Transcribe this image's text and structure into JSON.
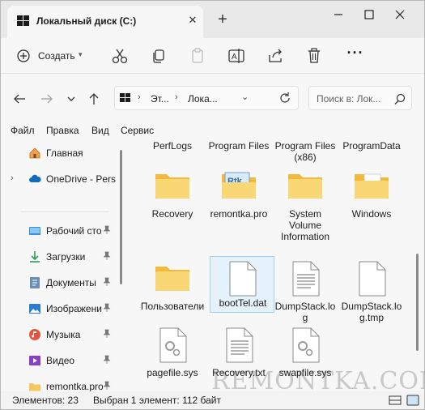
{
  "titlebar": {
    "tab_title": "Локальный диск (C:)",
    "close_glyph": "✕",
    "new_tab_glyph": "+"
  },
  "toolbar": {
    "create_label": "Создать",
    "buttons": [
      "cut-icon",
      "copy-icon",
      "paste-icon",
      "rename-icon",
      "share-icon",
      "delete-icon"
    ],
    "more_glyph": "···"
  },
  "address": {
    "segments": [
      "Эт...",
      "Лока..."
    ],
    "separator": "›",
    "search_placeholder": "Поиск в: Лок..."
  },
  "menu": [
    "Файл",
    "Правка",
    "Вид",
    "Сервис"
  ],
  "sidebar": {
    "items": [
      {
        "label": "Главная",
        "icon": "home-icon",
        "pinned": false,
        "chevron": false
      },
      {
        "label": "OneDrive - Perso",
        "icon": "cloud-icon",
        "pinned": false,
        "chevron": true
      },
      {
        "label": "Рабочий сто",
        "icon": "desktop-icon",
        "pinned": true,
        "chevron": false
      },
      {
        "label": "Загрузки",
        "icon": "download-icon",
        "pinned": true,
        "chevron": false
      },
      {
        "label": "Документы",
        "icon": "documents-icon",
        "pinned": true,
        "chevron": false
      },
      {
        "label": "Изображени",
        "icon": "pictures-icon",
        "pinned": true,
        "chevron": false
      },
      {
        "label": "Музыка",
        "icon": "music-icon",
        "pinned": true,
        "chevron": false
      },
      {
        "label": "Видео",
        "icon": "video-icon",
        "pinned": true,
        "chevron": false
      },
      {
        "label": "remontka.pro",
        "icon": "folder-icon",
        "pinned": true,
        "chevron": false
      }
    ]
  },
  "files": [
    {
      "name": "PerfLogs",
      "type": "folder"
    },
    {
      "name": "Program Files",
      "type": "folder"
    },
    {
      "name": "Program Files (x86)",
      "type": "folder"
    },
    {
      "name": "ProgramData",
      "type": "folder"
    },
    {
      "name": "Recovery",
      "type": "folder"
    },
    {
      "name": "remontka.pro",
      "type": "folder-image"
    },
    {
      "name": "System Volume Information",
      "type": "folder"
    },
    {
      "name": "Windows",
      "type": "folder-docs"
    },
    {
      "name": "Пользователи",
      "type": "folder"
    },
    {
      "name": "bootTel.dat",
      "type": "file-blank",
      "selected": true
    },
    {
      "name": "DumpStack.log",
      "type": "file-text"
    },
    {
      "name": "DumpStack.log.tmp",
      "type": "file-blank"
    },
    {
      "name": "pagefile.sys",
      "type": "file-sys"
    },
    {
      "name": "Recovery.txt",
      "type": "file-text"
    },
    {
      "name": "swapfile.sys",
      "type": "file-sys"
    }
  ],
  "status": {
    "items_count": "Элементов: 23",
    "selection": "Выбран 1 элемент: 112 байт"
  },
  "watermark": "REMONTKA.COM",
  "colors": {
    "folder": "#f6c85f",
    "selection_bg": "#e5f1fb",
    "selection_border": "#99d1ff",
    "accent": "#0067c0"
  }
}
